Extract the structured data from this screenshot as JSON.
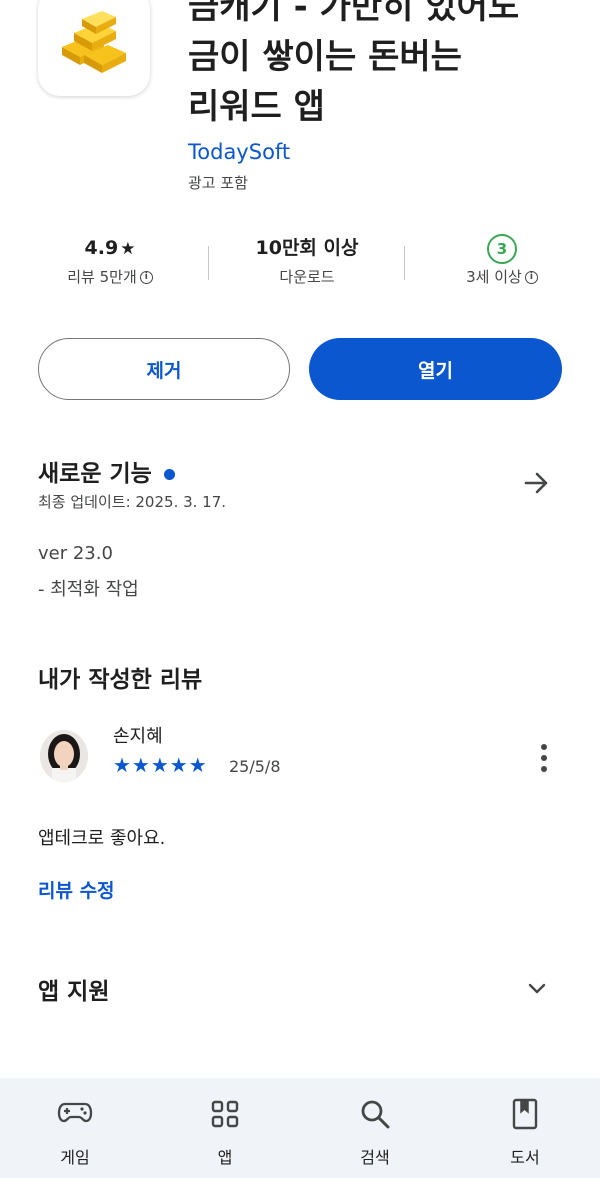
{
  "app": {
    "title_lines": [
      "금캐기 - 가만히 있어도",
      "금이 쌓이는 돈버는",
      "리워드 앱"
    ],
    "developer": "TodaySoft",
    "ads": "광고 포함",
    "icon": "gold-bars-icon"
  },
  "stats": {
    "rating": "4.9",
    "rating_star": "★",
    "reviews": "리뷰 5만개",
    "downloads": "10만회 이상",
    "downloads_label": "다운로드",
    "age_badge": "3",
    "age_label": "3세 이상"
  },
  "buttons": {
    "remove": "제거",
    "open": "열기"
  },
  "whats_new": {
    "title": "새로운 기능",
    "updated": "최종 업데이트: 2025. 3. 17.",
    "version": "ver 23.0",
    "notes": "- 최적화 작업"
  },
  "my_review": {
    "title": "내가 작성한 리뷰",
    "reviewer": "손지혜",
    "stars": "★★★★★",
    "rating": 5,
    "date": "25/5/8",
    "text": "앱테크로 좋아요.",
    "edit_label": "리뷰 수정"
  },
  "app_support": {
    "title": "앱 지원"
  },
  "nav": [
    {
      "label": "게임",
      "icon": "gamepad-icon"
    },
    {
      "label": "앱",
      "icon": "apps-grid-icon"
    },
    {
      "label": "검색",
      "icon": "search-icon"
    },
    {
      "label": "도서",
      "icon": "book-icon"
    }
  ],
  "colors": {
    "accent": "#0b57d0",
    "age_green": "#3aa757",
    "nav_bg": "#f0f4f9"
  }
}
